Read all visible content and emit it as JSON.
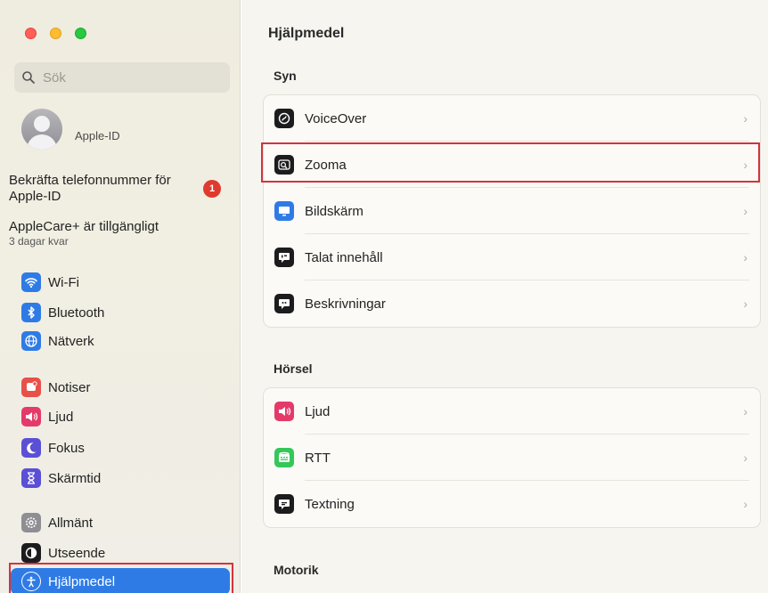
{
  "window": {
    "title": "Hjälpmedel"
  },
  "sidebar": {
    "search_placeholder": "Sök",
    "account": {
      "name": "Apple-ID"
    },
    "notice_confirm": "Bekräfta telefonnummer för Apple-ID",
    "notice_badge": "1",
    "applecare": {
      "title": "AppleCare+ är tillgängligt",
      "subtitle": "3 dagar kvar"
    },
    "items": [
      {
        "label": "Wi-Fi",
        "icon": "wifi-icon",
        "color": "#2f7be6"
      },
      {
        "label": "Bluetooth",
        "icon": "bluetooth-icon",
        "color": "#2f7be6"
      },
      {
        "label": "Nätverk",
        "icon": "globe-icon",
        "color": "#2f7be6"
      },
      {
        "label": "Notiser",
        "icon": "bell-icon",
        "color": "#e8504a"
      },
      {
        "label": "Ljud",
        "icon": "speaker-icon",
        "color": "#e43a6a"
      },
      {
        "label": "Fokus",
        "icon": "moon-icon",
        "color": "#5b4fd6"
      },
      {
        "label": "Skärmtid",
        "icon": "hourglass-icon",
        "color": "#5b4fd6"
      },
      {
        "label": "Allmänt",
        "icon": "gear-icon",
        "color": "#8e8e93"
      },
      {
        "label": "Utseende",
        "icon": "appearance-icon",
        "color": "#1c1c1e"
      },
      {
        "label": "Hjälpmedel",
        "icon": "accessibility-icon",
        "color": "#2f7be6",
        "active": true
      }
    ]
  },
  "main": {
    "title": "Hjälpmedel",
    "sections": [
      {
        "title": "Syn",
        "rows": [
          {
            "label": "VoiceOver",
            "icon": "voiceover-icon",
            "color": "#1c1c1e"
          },
          {
            "label": "Zooma",
            "icon": "zoom-icon",
            "color": "#1c1c1e",
            "highlighted": true
          },
          {
            "label": "Bildskärm",
            "icon": "display-icon",
            "color": "#2f7be6"
          },
          {
            "label": "Talat innehåll",
            "icon": "spoken-content-icon",
            "color": "#1c1c1e"
          },
          {
            "label": "Beskrivningar",
            "icon": "descriptions-icon",
            "color": "#1c1c1e"
          }
        ]
      },
      {
        "title": "Hörsel",
        "rows": [
          {
            "label": "Ljud",
            "icon": "speaker-icon",
            "color": "#e43a6a"
          },
          {
            "label": "RTT",
            "icon": "rtt-icon",
            "color": "#34c759"
          },
          {
            "label": "Textning",
            "icon": "captions-icon",
            "color": "#1c1c1e"
          }
        ]
      },
      {
        "title": "Motorik",
        "rows": []
      }
    ]
  },
  "colors": {
    "accent": "#2f7be6",
    "highlight_outline": "#d2333f",
    "badge": "#e03a2e"
  }
}
